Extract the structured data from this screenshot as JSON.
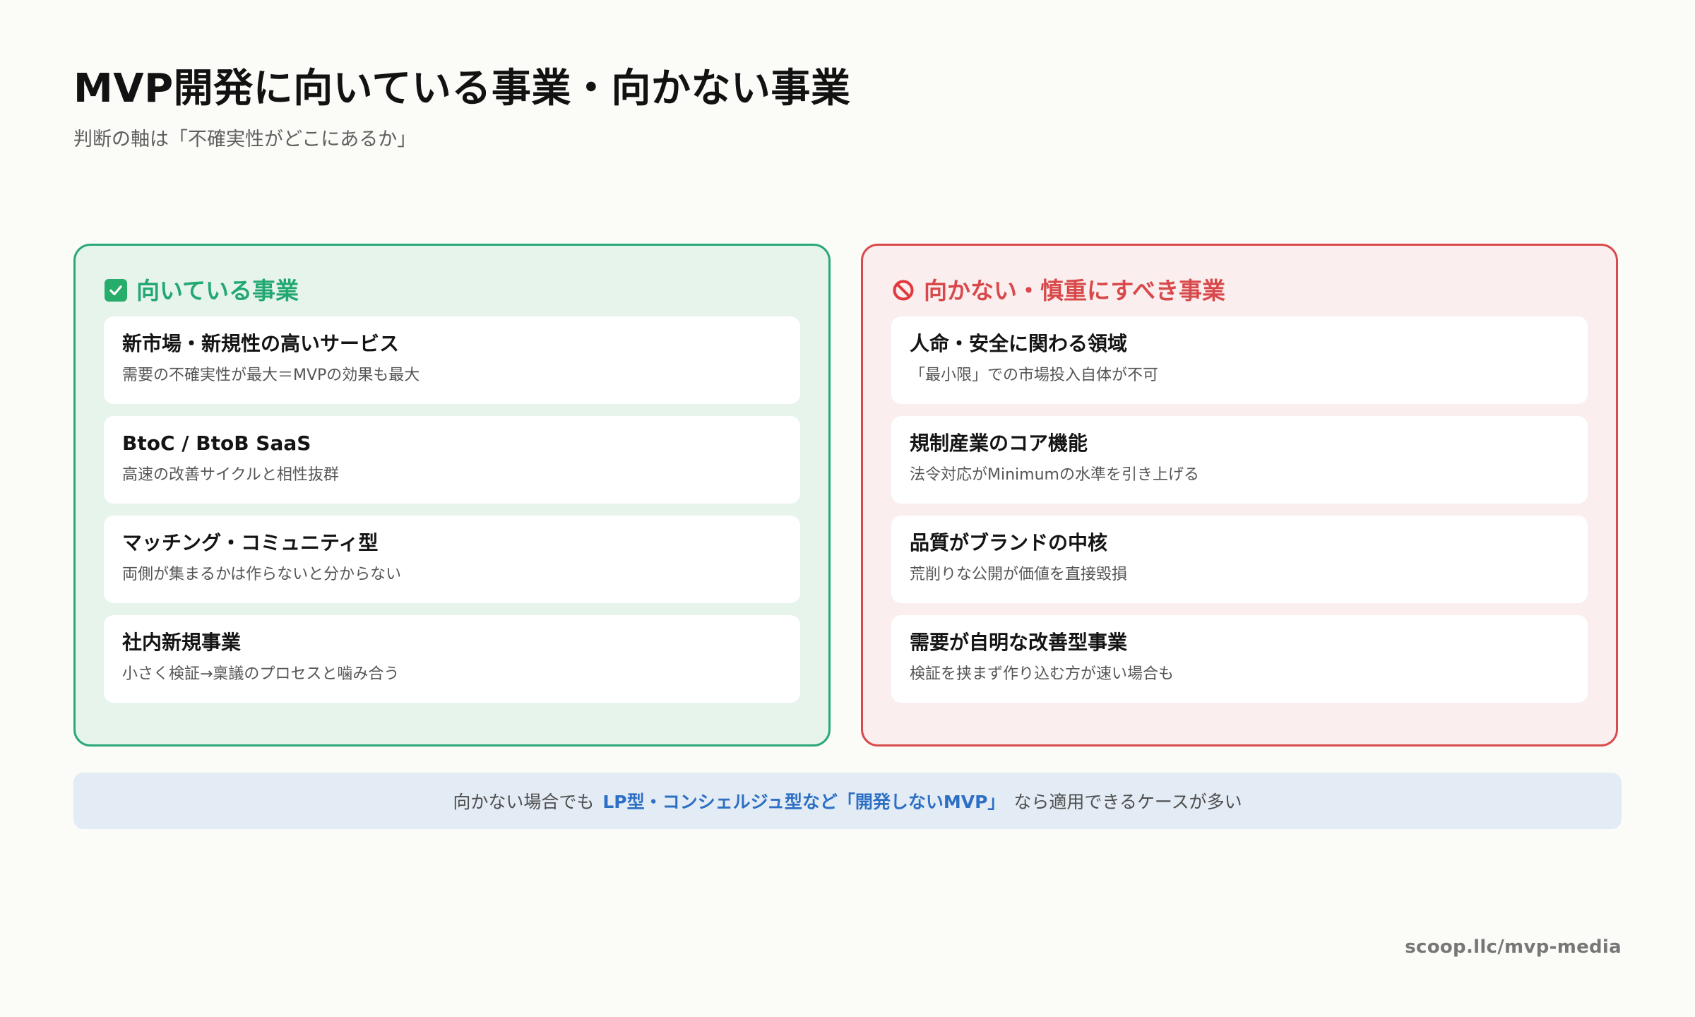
{
  "header": {
    "title": "MVP開発に向いている事業・向かない事業",
    "subtitle": "判断の軸は「不確実性がどこにあるか」"
  },
  "suitable": {
    "heading": "向いている事業",
    "icon": "check-mark-icon",
    "color": "#23a872",
    "items": [
      {
        "title": "新市場・新規性の高いサービス",
        "desc": "需要の不確実性が最大＝MVPの効果も最大"
      },
      {
        "title": "BtoC / BtoB SaaS",
        "desc": "高速の改善サイクルと相性抜群"
      },
      {
        "title": "マッチング・コミュニティ型",
        "desc": "両側が集まるかは作らないと分からない"
      },
      {
        "title": "社内新規事業",
        "desc": "小さく検証→稟議のプロセスと噛み合う"
      }
    ]
  },
  "unsuitable": {
    "heading": "向かない・慎重にすべき事業",
    "icon": "prohibited-icon",
    "color": "#d8494b",
    "items": [
      {
        "title": "人命・安全に関わる領域",
        "desc": "「最小限」での市場投入自体が不可"
      },
      {
        "title": "規制産業のコア機能",
        "desc": "法令対応がMinimumの水準を引き上げる"
      },
      {
        "title": "品質がブランドの中核",
        "desc": "荒削りな公開が価値を直接毀損"
      },
      {
        "title": "需要が自明な改善型事業",
        "desc": "検証を挟まず作り込む方が速い場合も"
      }
    ]
  },
  "note": {
    "before": "向かない場合でも",
    "highlight": "LP型・コンシェルジュ型など「開発しないMVP」",
    "after": "なら適用できるケースが多い"
  },
  "footer": {
    "source": "scoop.llc/mvp-media"
  }
}
